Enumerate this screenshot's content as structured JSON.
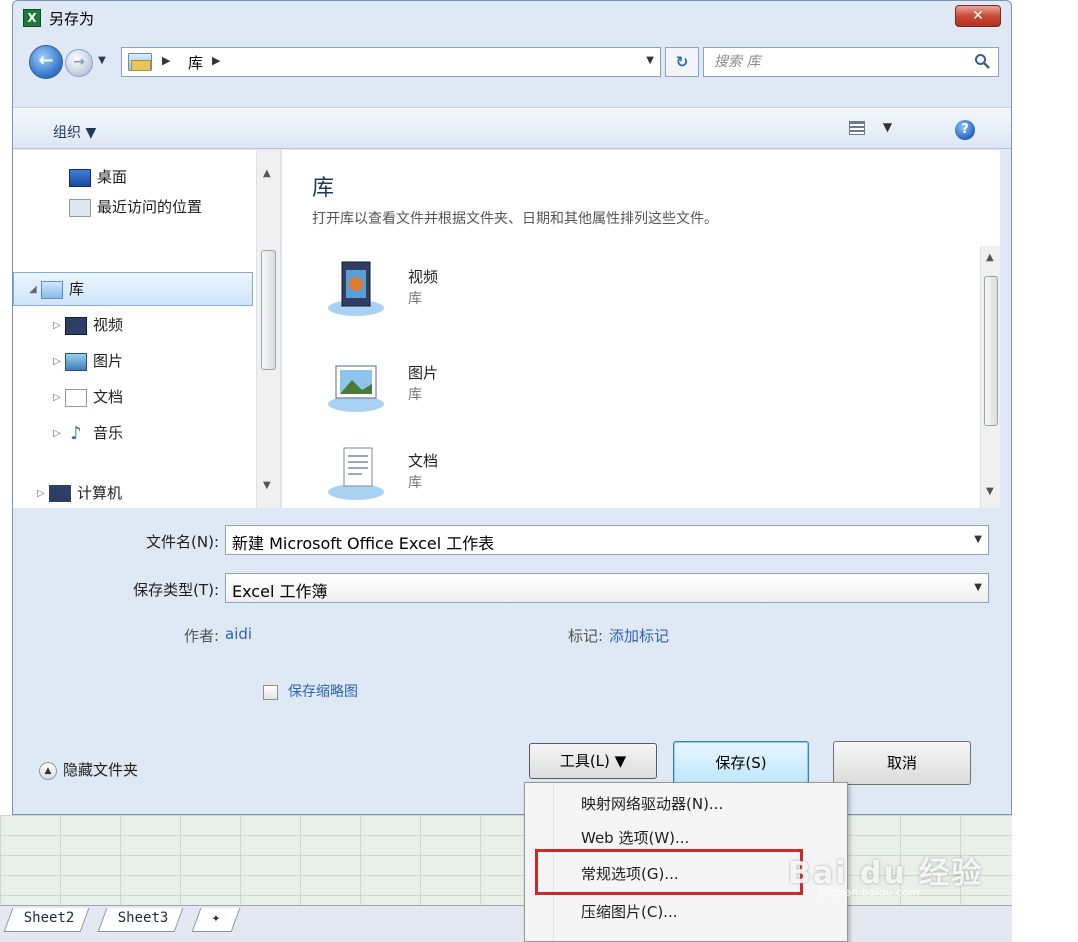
{
  "window": {
    "title": "另存为"
  },
  "address": {
    "location": "库"
  },
  "search": {
    "placeholder": "搜索 库"
  },
  "toolbar": {
    "organize_label": "组织 ▼"
  },
  "nav": {
    "items": [
      {
        "label": "桌面"
      },
      {
        "label": "最近访问的位置"
      },
      {
        "label": "库"
      },
      {
        "label": "视频"
      },
      {
        "label": "图片"
      },
      {
        "label": "文档"
      },
      {
        "label": "音乐"
      },
      {
        "label": "计算机"
      }
    ]
  },
  "content": {
    "title": "库",
    "subtitle": "打开库以查看文件并根据文件夹、日期和其他属性排列这些文件。",
    "libraries": [
      {
        "name": "视频",
        "sub": "库"
      },
      {
        "name": "图片",
        "sub": "库"
      },
      {
        "name": "文档",
        "sub": "库"
      }
    ]
  },
  "form": {
    "filename_label": "文件名(N):",
    "filename_value": "新建 Microsoft Office Excel 工作表",
    "filetype_label": "保存类型(T):",
    "filetype_value": "Excel 工作簿",
    "author_label": "作者:",
    "author_value": "aidi",
    "tags_label": "标记:",
    "tags_value": "添加标记",
    "thumbnail_label": "保存缩略图"
  },
  "footer": {
    "hide_folders": "隐藏文件夹",
    "tools_label": "工具(L)  ▼",
    "save_label": "保存(S)",
    "cancel_label": "取消"
  },
  "tools_menu": {
    "items": [
      {
        "label": "映射网络驱动器(N)..."
      },
      {
        "label": "Web 选项(W)..."
      },
      {
        "label": "常规选项(G)..."
      },
      {
        "label": "压缩图片(C)..."
      }
    ]
  },
  "excel": {
    "sheet_tabs": [
      {
        "label": "Sheet2"
      },
      {
        "label": "Sheet3"
      }
    ]
  },
  "watermark": {
    "text": "Bai du 经验",
    "url": "jingyan.baidu.com"
  },
  "colors": {
    "accent": "#2c63b8",
    "highlight_border": "#d02828",
    "close_button": "#c94b37"
  }
}
